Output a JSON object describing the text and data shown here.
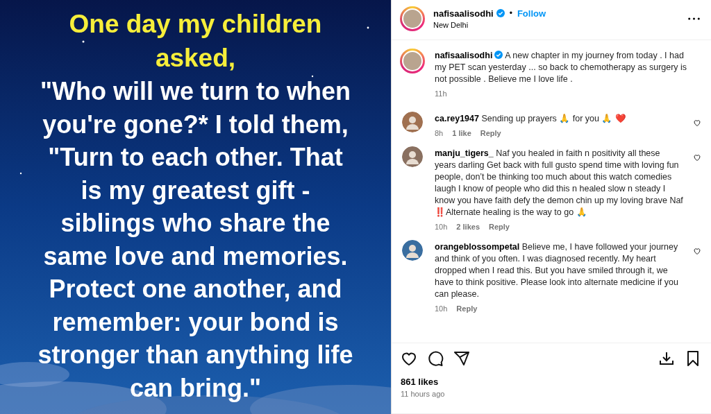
{
  "post_image": {
    "kind": "picture",
    "heading": [
      "One day my children",
      "asked,"
    ],
    "body": [
      "\"Who will we turn to when",
      "you're gone?* I told them,",
      "\"Turn to each other. That",
      "is my greatest gift -",
      "siblings who share the",
      "same love and memories.",
      "Protect one another, and",
      "remember: your bond is",
      "stronger than anything life",
      "can bring.\""
    ]
  },
  "header": {
    "username": "nafisaalisodhi",
    "verified": true,
    "separator": "•",
    "follow": "Follow",
    "location": "New Delhi"
  },
  "caption": {
    "username": "nafisaalisodhi",
    "verified": true,
    "text": "A new chapter in my journey from today . I had my PET scan yesterday ... so back to chemotherapy as surgery is not possible . Believe me I love life .",
    "time": "11h"
  },
  "comments": [
    {
      "username": "ca.rey1947",
      "text": "Sending up prayers 🙏 for you 🙏 ❤️",
      "time": "8h",
      "likes": "1 like",
      "reply": "Reply"
    },
    {
      "username": "manju_tigers_",
      "text": "Naf you healed in faith n positivity all these years darling Get back with full gusto spend time with loving fun people, don’t be thinking too much about this watch comedies laugh I know of people who did this n healed slow n steady I know you have faith defy the demon chin up my loving brave Naf ‼️Alternate healing is the way to go 🙏",
      "time": "10h",
      "likes": "2 likes",
      "reply": "Reply"
    },
    {
      "username": "orangeblossompetal",
      "text": "Believe me, I have followed your journey and think of you often. I was diagnosed recently. My heart dropped when I read this. But you have smiled through it, we have to think positive. Please look into alternate medicine if you can please.",
      "time": "10h",
      "reply": "Reply"
    }
  ],
  "likes": "861 likes",
  "posted": "11 hours ago"
}
